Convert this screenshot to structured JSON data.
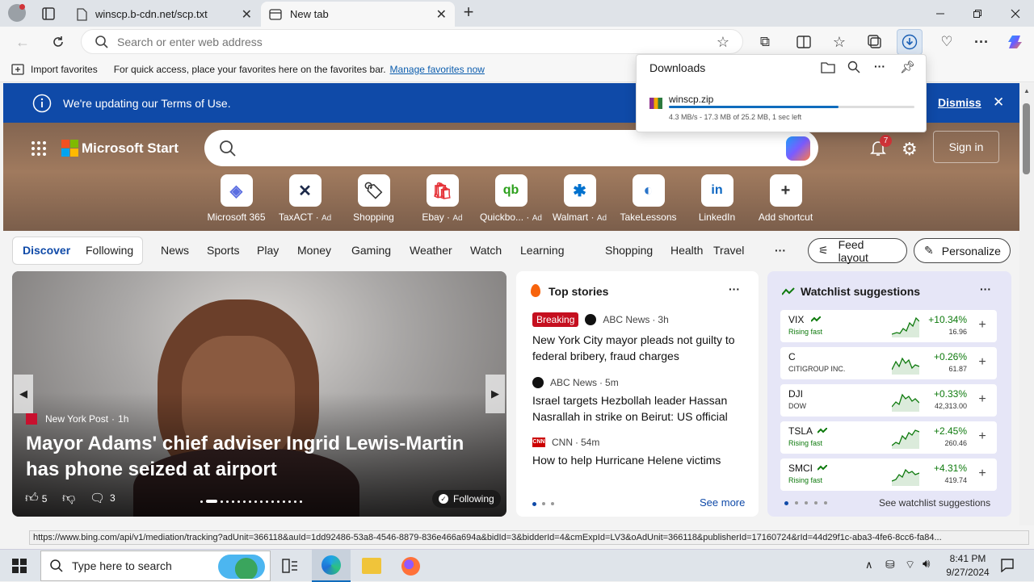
{
  "tabs": [
    {
      "title": "winscp.b-cdn.net/scp.txt"
    },
    {
      "title": "New tab"
    }
  ],
  "toolbar": {
    "address_placeholder": "Search or enter web address"
  },
  "favorites_bar": {
    "import_label": "Import favorites",
    "message": "For quick access, place your favorites here on the favorites bar.",
    "manage_link": "Manage favorites now"
  },
  "downloads": {
    "title": "Downloads",
    "file": "winscp.zip",
    "progress": 0.69,
    "status": "4.3 MB/s - 17.3 MB of 25.2 MB, 1 sec left"
  },
  "banner": {
    "message": "We're updating our Terms of Use.",
    "dismiss": "Dismiss"
  },
  "header": {
    "brand": "Microsoft Start",
    "notification_count": "7",
    "sign_in": "Sign in"
  },
  "shortcuts": [
    {
      "label": "Microsoft 365",
      "ad": ""
    },
    {
      "label": "TaxACT",
      "ad": "Ad"
    },
    {
      "label": "Shopping",
      "ad": ""
    },
    {
      "label": "Ebay",
      "ad": "Ad"
    },
    {
      "label": "Quickbo...",
      "ad": "Ad"
    },
    {
      "label": "Walmart",
      "ad": "Ad"
    },
    {
      "label": "TakeLessons",
      "ad": ""
    },
    {
      "label": "LinkedIn",
      "ad": ""
    },
    {
      "label": "Add shortcut",
      "ad": ""
    }
  ],
  "nav": {
    "discover": "Discover",
    "following": "Following",
    "items": [
      "News",
      "Sports",
      "Play",
      "Money",
      "Gaming",
      "Weather",
      "Watch",
      "Learning",
      "Shopping",
      "Health",
      "Travel"
    ],
    "more": "···",
    "feed_layout": "Feed layout",
    "personalize": "Personalize"
  },
  "hero_story": {
    "source": "New York Post",
    "age": "1h",
    "title": "Mayor Adams' chief adviser Ingrid Lewis-Martin has phone seized at airport",
    "likes": "5",
    "comments": "3",
    "following": "Following"
  },
  "top_stories": {
    "title": "Top stories",
    "see_more": "See more",
    "items": [
      {
        "badge": "Breaking",
        "source": "ABC News",
        "age": "3h",
        "title": "New York City mayor pleads not guilty to federal bribery, fraud charges"
      },
      {
        "badge": "",
        "source": "ABC News",
        "age": "5m",
        "title": "Israel targets Hezbollah leader Hassan Nasrallah in strike on Beirut: US official"
      },
      {
        "badge": "",
        "source": "CNN",
        "age": "54m",
        "title": "How to help Hurricane Helene victims"
      }
    ]
  },
  "watchlist": {
    "title": "Watchlist suggestions",
    "see_more": "See watchlist suggestions",
    "items": [
      {
        "symbol": "VIX",
        "sub": "Rising fast",
        "change": "+10.34%",
        "price": "16.96"
      },
      {
        "symbol": "C",
        "sub": "CITIGROUP INC.",
        "change": "+0.26%",
        "price": "61.87"
      },
      {
        "symbol": "DJI",
        "sub": "DOW",
        "change": "+0.33%",
        "price": "42,313.00"
      },
      {
        "symbol": "TSLA",
        "sub": "Rising fast",
        "change": "+2.45%",
        "price": "260.46"
      },
      {
        "symbol": "SMCI",
        "sub": "Rising fast",
        "change": "+4.31%",
        "price": "419.74"
      }
    ]
  },
  "status_url": "https://www.bing.com/api/v1/mediation/tracking?adUnit=366118&auId=1dd92486-53a8-4546-8879-836e466a694a&bidId=3&bidderId=4&cmExpId=LV3&oAdUnit=366118&publisherId=17160724&rId=44d29f1c-aba3-4fe6-8cc6-fa84...",
  "taskbar": {
    "search_placeholder": "Type here to search",
    "time": "8:41 PM",
    "date": "9/27/2024"
  },
  "colors": {
    "accent": "#0f4aa8",
    "positive": "#0e7a0d",
    "breaking": "#c50f1f"
  }
}
